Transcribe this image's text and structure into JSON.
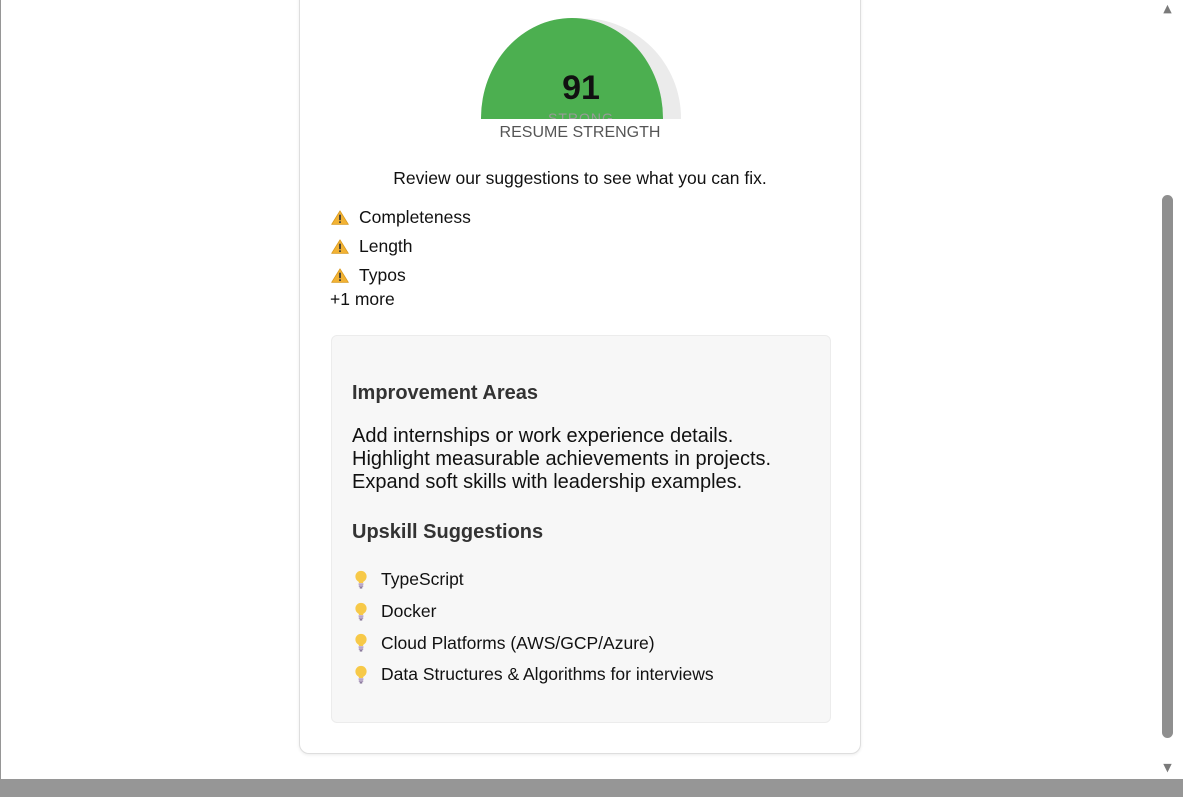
{
  "gauge": {
    "score": "91",
    "rating": "STRONG",
    "caption": "RESUME STRENGTH",
    "fill_color": "#4caf50",
    "track_color": "#ebebeb"
  },
  "review_text": "Review our suggestions to see what you can fix.",
  "issues": [
    {
      "icon": "warning-icon",
      "label": "Completeness"
    },
    {
      "icon": "warning-icon",
      "label": "Length"
    },
    {
      "icon": "warning-icon",
      "label": "Typos"
    }
  ],
  "more_label": "+1 more",
  "improvement": {
    "heading": "Improvement Areas",
    "lines": [
      "Add internships or work experience details.",
      "Highlight measurable achievements in projects.",
      "Expand soft skills with leadership examples."
    ]
  },
  "upskill": {
    "heading": "Upskill Suggestions",
    "items": [
      {
        "icon": "lightbulb-icon",
        "label": "TypeScript"
      },
      {
        "icon": "lightbulb-icon",
        "label": "Docker"
      },
      {
        "icon": "lightbulb-icon",
        "label": "Cloud Platforms (AWS/GCP/Azure)"
      },
      {
        "icon": "lightbulb-icon",
        "label": "Data Structures & Algorithms for interviews"
      }
    ]
  },
  "scrollbar": {
    "up_icon": "scroll-up-arrow-icon",
    "down_icon": "scroll-down-arrow-icon"
  }
}
